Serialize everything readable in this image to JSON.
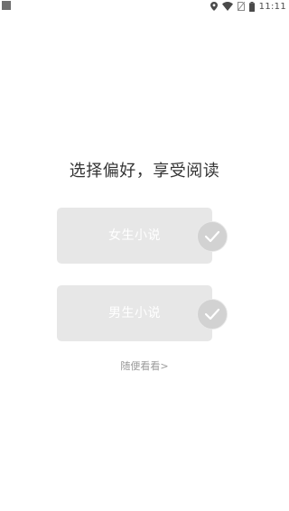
{
  "status_bar": {
    "time": "11:11",
    "icons": [
      "notification-icon",
      "location-icon",
      "wifi-icon",
      "no-sim-icon",
      "battery-icon"
    ]
  },
  "main": {
    "heading": "选择偏好，享受阅读",
    "choices": [
      {
        "label": "女生小说",
        "icon": "check-icon"
      },
      {
        "label": "男生小说",
        "icon": "check-icon"
      }
    ],
    "browse_link": "随便看看>"
  },
  "colors": {
    "background": "#ffffff",
    "card": "#e7e7e7",
    "check_circle": "#d2d2d2",
    "heading_text": "#333333",
    "link_text": "#9a9a9a"
  }
}
